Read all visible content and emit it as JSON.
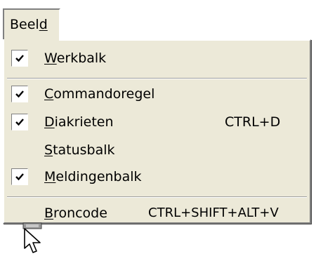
{
  "menubar": {
    "label_pre": "Beel",
    "label_accel": "d"
  },
  "menu": {
    "werkbalk": {
      "accel": "W",
      "rest": "erkbalk",
      "checked": true
    },
    "commandoregel": {
      "accel": "C",
      "rest": "ommandoregel",
      "checked": true
    },
    "diakrieten": {
      "accel": "D",
      "rest": "iakrieten",
      "shortcut": "CTRL+D",
      "checked": true
    },
    "statusbalk": {
      "accel": "S",
      "rest": "tatusbalk",
      "checked": false
    },
    "meldingenbalk": {
      "accel": "M",
      "rest": "eldingenbalk",
      "checked": true
    },
    "broncode": {
      "accel": "B",
      "rest": "roncode",
      "shortcut": "CTRL+SHIFT+ALT+V",
      "checked": false
    }
  },
  "icons": {
    "check": "check-icon",
    "cursor": "mouse-pointer-icon"
  },
  "colors": {
    "menu_bg": "#ece9d8",
    "shadow": "#808080",
    "highlight": "#ffffff"
  }
}
